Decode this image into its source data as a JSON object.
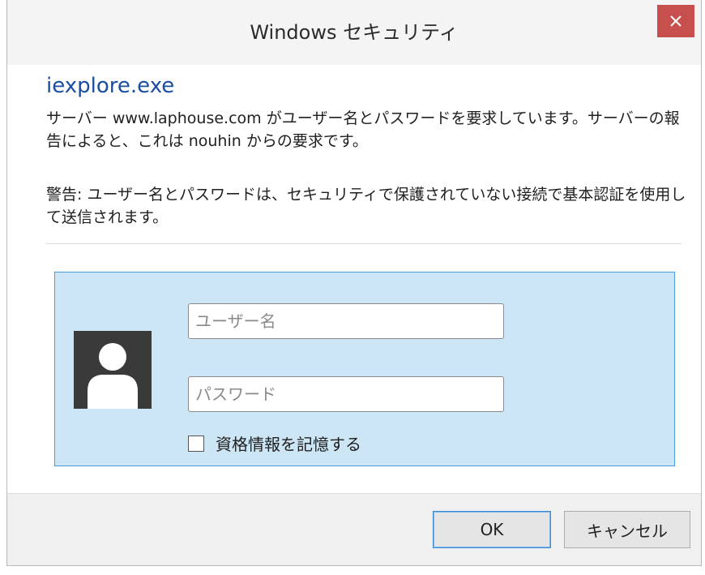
{
  "window": {
    "title": "Windows セキュリティ",
    "close_icon": "close-icon"
  },
  "dialog": {
    "app_name": "iexplore.exe",
    "message": "サーバー www.laphouse.com がユーザー名とパスワードを要求しています。サーバーの報告によると、これは nouhin からの要求です。",
    "warning": "警告: ユーザー名とパスワードは、セキュリティで保護されていない接続で基本認証を使用して送信されます。"
  },
  "credentials": {
    "user_icon": "user-avatar-icon",
    "username": {
      "value": "",
      "placeholder": "ユーザー名"
    },
    "password": {
      "value": "",
      "placeholder": "パスワード"
    },
    "remember_label": "資格情報を記憶する",
    "remember_checked": false
  },
  "buttons": {
    "ok_label": "OK",
    "cancel_label": "キャンセル"
  },
  "colors": {
    "link_blue": "#1a4ea0",
    "panel_bg": "#cde6f5",
    "panel_border": "#4c9ad6",
    "close_red": "#c7504f"
  }
}
